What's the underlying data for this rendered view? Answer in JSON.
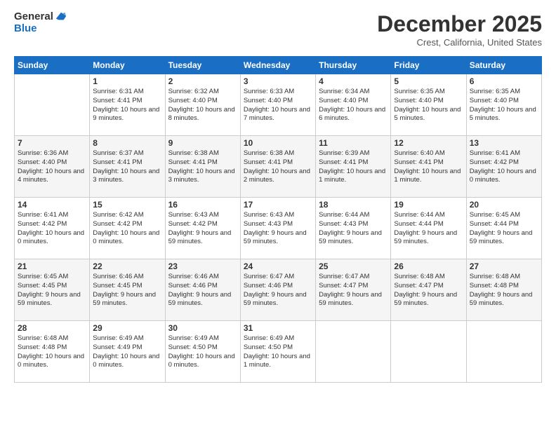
{
  "logo": {
    "general": "General",
    "blue": "Blue"
  },
  "header": {
    "month": "December 2025",
    "location": "Crest, California, United States"
  },
  "weekdays": [
    "Sunday",
    "Monday",
    "Tuesday",
    "Wednesday",
    "Thursday",
    "Friday",
    "Saturday"
  ],
  "weeks": [
    [
      {
        "day": "",
        "empty": true
      },
      {
        "day": "1",
        "sunrise": "Sunrise: 6:31 AM",
        "sunset": "Sunset: 4:41 PM",
        "daylight": "Daylight: 10 hours and 9 minutes."
      },
      {
        "day": "2",
        "sunrise": "Sunrise: 6:32 AM",
        "sunset": "Sunset: 4:40 PM",
        "daylight": "Daylight: 10 hours and 8 minutes."
      },
      {
        "day": "3",
        "sunrise": "Sunrise: 6:33 AM",
        "sunset": "Sunset: 4:40 PM",
        "daylight": "Daylight: 10 hours and 7 minutes."
      },
      {
        "day": "4",
        "sunrise": "Sunrise: 6:34 AM",
        "sunset": "Sunset: 4:40 PM",
        "daylight": "Daylight: 10 hours and 6 minutes."
      },
      {
        "day": "5",
        "sunrise": "Sunrise: 6:35 AM",
        "sunset": "Sunset: 4:40 PM",
        "daylight": "Daylight: 10 hours and 5 minutes."
      },
      {
        "day": "6",
        "sunrise": "Sunrise: 6:35 AM",
        "sunset": "Sunset: 4:40 PM",
        "daylight": "Daylight: 10 hours and 5 minutes."
      }
    ],
    [
      {
        "day": "7",
        "sunrise": "Sunrise: 6:36 AM",
        "sunset": "Sunset: 4:40 PM",
        "daylight": "Daylight: 10 hours and 4 minutes."
      },
      {
        "day": "8",
        "sunrise": "Sunrise: 6:37 AM",
        "sunset": "Sunset: 4:41 PM",
        "daylight": "Daylight: 10 hours and 3 minutes."
      },
      {
        "day": "9",
        "sunrise": "Sunrise: 6:38 AM",
        "sunset": "Sunset: 4:41 PM",
        "daylight": "Daylight: 10 hours and 3 minutes."
      },
      {
        "day": "10",
        "sunrise": "Sunrise: 6:38 AM",
        "sunset": "Sunset: 4:41 PM",
        "daylight": "Daylight: 10 hours and 2 minutes."
      },
      {
        "day": "11",
        "sunrise": "Sunrise: 6:39 AM",
        "sunset": "Sunset: 4:41 PM",
        "daylight": "Daylight: 10 hours and 1 minute."
      },
      {
        "day": "12",
        "sunrise": "Sunrise: 6:40 AM",
        "sunset": "Sunset: 4:41 PM",
        "daylight": "Daylight: 10 hours and 1 minute."
      },
      {
        "day": "13",
        "sunrise": "Sunrise: 6:41 AM",
        "sunset": "Sunset: 4:42 PM",
        "daylight": "Daylight: 10 hours and 0 minutes."
      }
    ],
    [
      {
        "day": "14",
        "sunrise": "Sunrise: 6:41 AM",
        "sunset": "Sunset: 4:42 PM",
        "daylight": "Daylight: 10 hours and 0 minutes."
      },
      {
        "day": "15",
        "sunrise": "Sunrise: 6:42 AM",
        "sunset": "Sunset: 4:42 PM",
        "daylight": "Daylight: 10 hours and 0 minutes."
      },
      {
        "day": "16",
        "sunrise": "Sunrise: 6:43 AM",
        "sunset": "Sunset: 4:42 PM",
        "daylight": "Daylight: 9 hours and 59 minutes."
      },
      {
        "day": "17",
        "sunrise": "Sunrise: 6:43 AM",
        "sunset": "Sunset: 4:43 PM",
        "daylight": "Daylight: 9 hours and 59 minutes."
      },
      {
        "day": "18",
        "sunrise": "Sunrise: 6:44 AM",
        "sunset": "Sunset: 4:43 PM",
        "daylight": "Daylight: 9 hours and 59 minutes."
      },
      {
        "day": "19",
        "sunrise": "Sunrise: 6:44 AM",
        "sunset": "Sunset: 4:44 PM",
        "daylight": "Daylight: 9 hours and 59 minutes."
      },
      {
        "day": "20",
        "sunrise": "Sunrise: 6:45 AM",
        "sunset": "Sunset: 4:44 PM",
        "daylight": "Daylight: 9 hours and 59 minutes."
      }
    ],
    [
      {
        "day": "21",
        "sunrise": "Sunrise: 6:45 AM",
        "sunset": "Sunset: 4:45 PM",
        "daylight": "Daylight: 9 hours and 59 minutes."
      },
      {
        "day": "22",
        "sunrise": "Sunrise: 6:46 AM",
        "sunset": "Sunset: 4:45 PM",
        "daylight": "Daylight: 9 hours and 59 minutes."
      },
      {
        "day": "23",
        "sunrise": "Sunrise: 6:46 AM",
        "sunset": "Sunset: 4:46 PM",
        "daylight": "Daylight: 9 hours and 59 minutes."
      },
      {
        "day": "24",
        "sunrise": "Sunrise: 6:47 AM",
        "sunset": "Sunset: 4:46 PM",
        "daylight": "Daylight: 9 hours and 59 minutes."
      },
      {
        "day": "25",
        "sunrise": "Sunrise: 6:47 AM",
        "sunset": "Sunset: 4:47 PM",
        "daylight": "Daylight: 9 hours and 59 minutes."
      },
      {
        "day": "26",
        "sunrise": "Sunrise: 6:48 AM",
        "sunset": "Sunset: 4:47 PM",
        "daylight": "Daylight: 9 hours and 59 minutes."
      },
      {
        "day": "27",
        "sunrise": "Sunrise: 6:48 AM",
        "sunset": "Sunset: 4:48 PM",
        "daylight": "Daylight: 9 hours and 59 minutes."
      }
    ],
    [
      {
        "day": "28",
        "sunrise": "Sunrise: 6:48 AM",
        "sunset": "Sunset: 4:48 PM",
        "daylight": "Daylight: 10 hours and 0 minutes."
      },
      {
        "day": "29",
        "sunrise": "Sunrise: 6:49 AM",
        "sunset": "Sunset: 4:49 PM",
        "daylight": "Daylight: 10 hours and 0 minutes."
      },
      {
        "day": "30",
        "sunrise": "Sunrise: 6:49 AM",
        "sunset": "Sunset: 4:50 PM",
        "daylight": "Daylight: 10 hours and 0 minutes."
      },
      {
        "day": "31",
        "sunrise": "Sunrise: 6:49 AM",
        "sunset": "Sunset: 4:50 PM",
        "daylight": "Daylight: 10 hours and 1 minute."
      },
      {
        "day": "",
        "empty": true
      },
      {
        "day": "",
        "empty": true
      },
      {
        "day": "",
        "empty": true
      }
    ]
  ]
}
